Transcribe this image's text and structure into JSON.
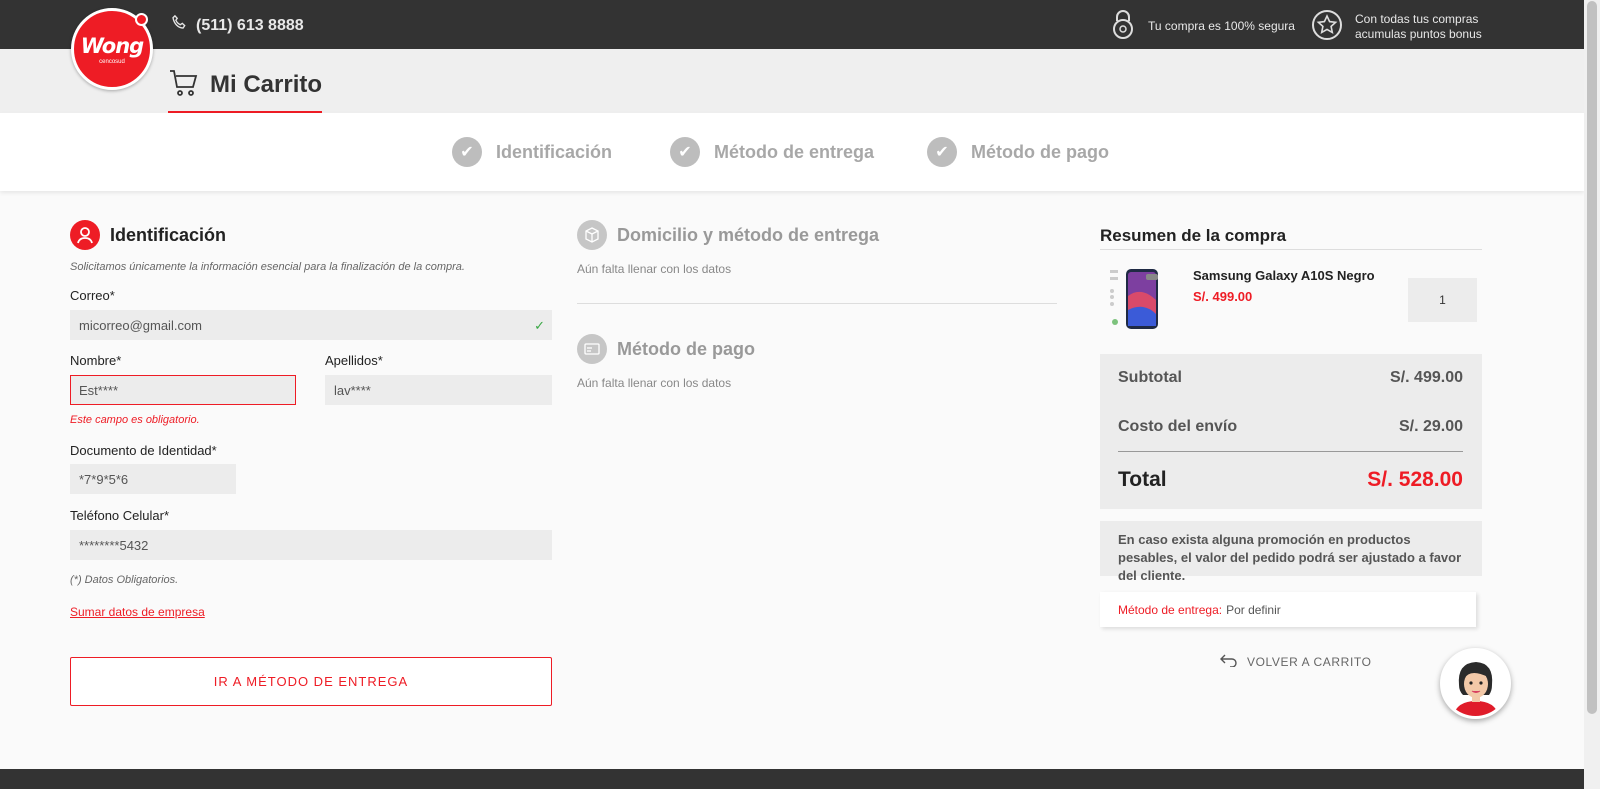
{
  "topbar": {
    "phone": "(511) 613 8888",
    "secure_text": "Tu compra es 100% segura",
    "points_line1": "Con todas tus compras",
    "points_line2": "acumulas puntos bonus"
  },
  "logo": {
    "brand": "Wong",
    "sub": "cencosud"
  },
  "header": {
    "title": "Mi Carrito"
  },
  "steps": [
    {
      "label": "Identificación"
    },
    {
      "label": "Método de entrega"
    },
    {
      "label": "Método de pago"
    }
  ],
  "identification": {
    "title": "Identificación",
    "hint": "Solicitamos únicamente la información esencial para la finalización de la compra.",
    "email_label": "Correo*",
    "email_value": "micorreo@gmail.com",
    "name_label": "Nombre*",
    "name_value": "Est****",
    "name_error": "Este campo es obligatorio.",
    "lastname_label": "Apellidos*",
    "lastname_value": "lav****",
    "doc_label": "Documento de Identidad*",
    "doc_value": "*7*9*5*6",
    "phone_label": "Teléfono Celular*",
    "phone_value": "********5432",
    "required_note": "(*) Datos Obligatorios.",
    "company_link": "Sumar datos de empresa",
    "submit_button": "IR A MÉTODO DE ENTREGA"
  },
  "delivery_section": {
    "title": "Domicilio y método de entrega",
    "sub": "Aún falta llenar con los datos"
  },
  "payment_section": {
    "title": "Método de pago",
    "sub": "Aún falta llenar con los datos"
  },
  "summary": {
    "title": "Resumen de la compra",
    "product_name": "Samsung Galaxy A10S Negro",
    "product_price": "S/. 499.00",
    "quantity": "1",
    "subtotal_label": "Subtotal",
    "subtotal_value": "S/. 499.00",
    "shipping_label": "Costo del envío",
    "shipping_value": "S/. 29.00",
    "total_label": "Total",
    "total_value": "S/. 528.00",
    "note": "En caso exista alguna promoción en productos pesables, el valor del pedido podrá ser ajustado a favor del cliente.",
    "delivery_method_label": "Método de entrega:",
    "delivery_method_value": "Por definir",
    "back_button": "VOLVER A CARRITO"
  },
  "colors": {
    "brand_red": "#ee1c25",
    "topbar": "#333333"
  }
}
